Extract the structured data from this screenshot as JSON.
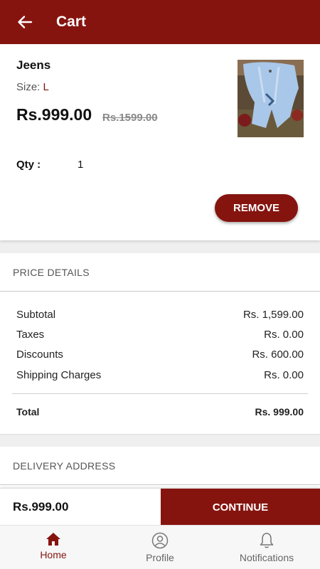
{
  "appbar": {
    "title": "Cart",
    "back_icon": "arrow-left-icon"
  },
  "item": {
    "name": "Jeens",
    "size_label": "Size:",
    "size_value": "L",
    "price": "Rs.999.00",
    "original_price": "Rs.1599.00",
    "qty_label": "Qty :",
    "qty_value": "1",
    "remove_label": "REMOVE"
  },
  "price_details": {
    "title": "PRICE DETAILS",
    "rows": [
      {
        "label": "Subtotal",
        "value": "Rs. 1,599.00"
      },
      {
        "label": "Taxes",
        "value": "Rs. 0.00"
      },
      {
        "label": "Discounts",
        "value": "Rs. 600.00"
      },
      {
        "label": "Shipping Charges",
        "value": "Rs. 0.00"
      }
    ],
    "total_label": "Total",
    "total_value": "Rs. 999.00"
  },
  "delivery": {
    "title": "DELIVERY ADDRESS"
  },
  "checkout": {
    "price": "Rs.999.00",
    "continue_label": "CONTINUE"
  },
  "nav": {
    "items": [
      {
        "label": "Home",
        "icon": "home-icon",
        "active": true
      },
      {
        "label": "Profile",
        "icon": "profile-icon",
        "active": false
      },
      {
        "label": "Notifications",
        "icon": "bell-icon",
        "active": false
      }
    ]
  },
  "colors": {
    "brand": "#85140f",
    "background": "#efefef"
  }
}
